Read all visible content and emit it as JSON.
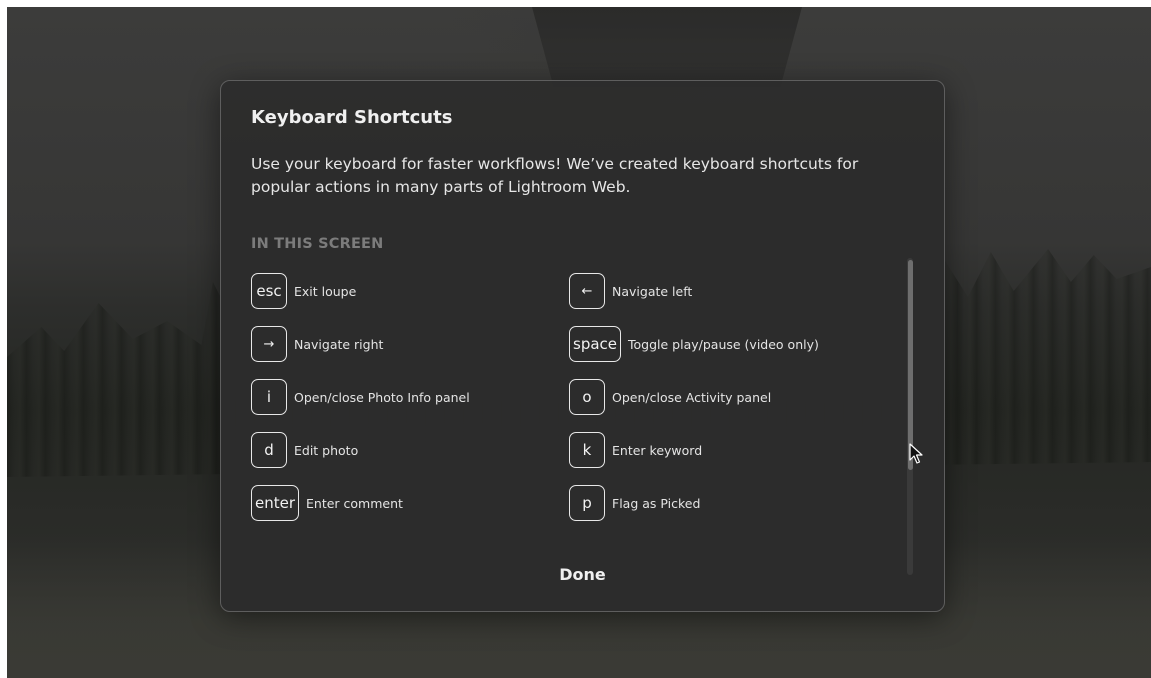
{
  "dialog": {
    "title": "Keyboard Shortcuts",
    "description": "Use your keyboard for faster workflows! We’ve created keyboard shortcuts for popular actions in many parts of Lightroom Web.",
    "section_label": "IN THIS SCREEN",
    "done_label": "Done"
  },
  "shortcuts": {
    "left": [
      {
        "key": "esc",
        "action": "Exit loupe"
      },
      {
        "key": "→",
        "action": "Navigate right"
      },
      {
        "key": "i",
        "action": "Open/close Photo Info panel"
      },
      {
        "key": "d",
        "action": "Edit photo"
      },
      {
        "key": "enter",
        "action": "Enter comment"
      }
    ],
    "right": [
      {
        "key": "←",
        "action": "Navigate left"
      },
      {
        "key": "space",
        "action": "Toggle play/pause (video only)"
      },
      {
        "key": "o",
        "action": "Open/close Activity panel"
      },
      {
        "key": "k",
        "action": "Enter keyword"
      },
      {
        "key": "p",
        "action": "Flag as Picked"
      }
    ]
  },
  "icons": {
    "cursor": "pointer-cursor-icon"
  }
}
